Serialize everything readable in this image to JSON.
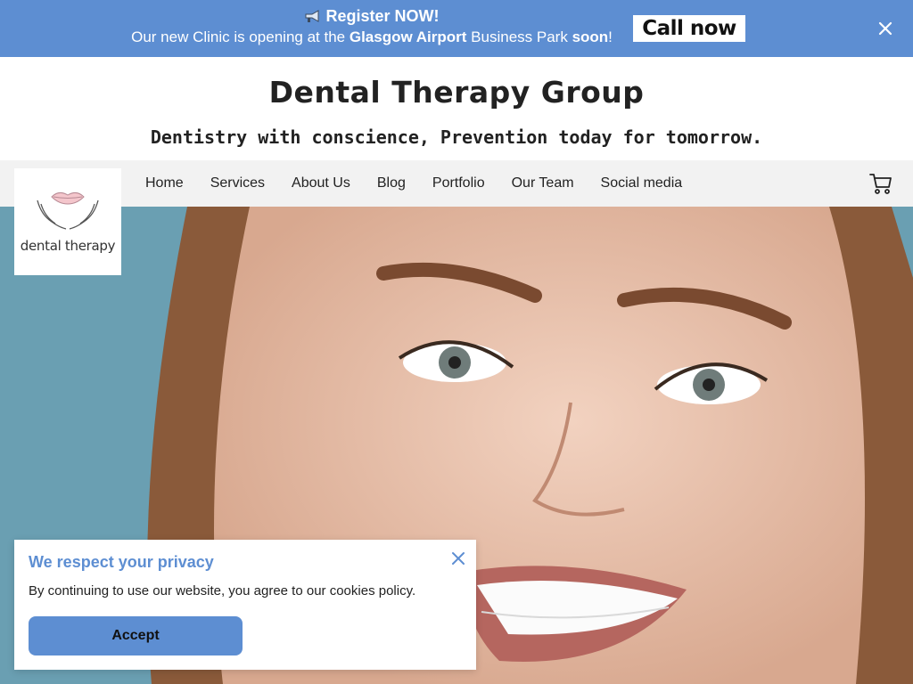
{
  "announcement": {
    "headline": "Register NOW!",
    "message_pre": "Our new Clinic is opening at the ",
    "message_location": "Glasgow Airport",
    "message_mid": " Business Park ",
    "message_soon": "soon",
    "message_end": "!",
    "cta_label": "Call now",
    "icon": "megaphone-icon",
    "close_icon": "close-icon"
  },
  "header": {
    "title": "Dental Therapy Group",
    "tagline": "Dentistry with conscience, Prevention today for tomorrow."
  },
  "logo": {
    "text": "dental therapy"
  },
  "nav": {
    "items": [
      {
        "label": "Home"
      },
      {
        "label": "Services"
      },
      {
        "label": "About Us"
      },
      {
        "label": "Blog"
      },
      {
        "label": "Portfolio"
      },
      {
        "label": "Our Team"
      },
      {
        "label": "Social media"
      }
    ],
    "cart_icon": "cart-icon"
  },
  "cookie": {
    "title": "We respect your privacy",
    "text": "By continuing to use our website, you agree to our cookies policy.",
    "accept_label": "Accept",
    "close_icon": "close-icon"
  },
  "colors": {
    "accent": "#5d8ed2",
    "nav_bg": "#f2f2f2",
    "hero_bg": "#6a9fb2"
  }
}
